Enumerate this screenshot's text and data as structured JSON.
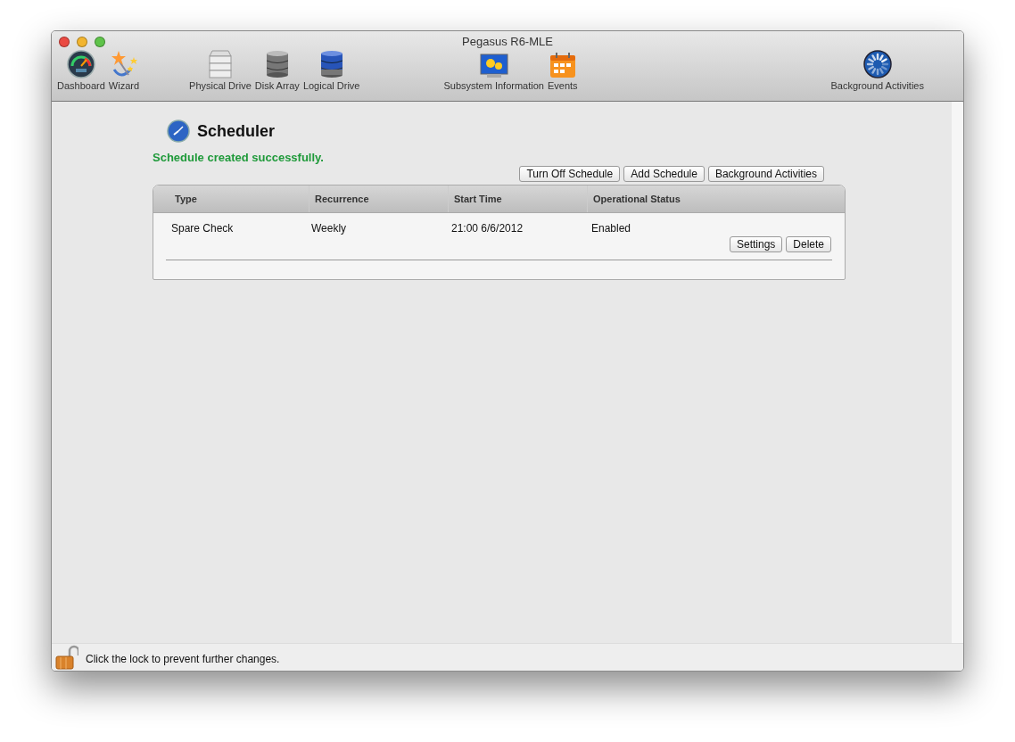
{
  "window": {
    "title": "Pegasus R6-MLE"
  },
  "toolbar": [
    {
      "label": "Dashboard",
      "kind": "gauge"
    },
    {
      "label": "Wizard",
      "kind": "wand"
    },
    {
      "label": "Physical Drive",
      "kind": "drive"
    },
    {
      "label": "Disk Array",
      "kind": "array"
    },
    {
      "label": "Logical Drive",
      "kind": "logical"
    },
    {
      "label": "Subsystem Information",
      "kind": "monitor"
    },
    {
      "label": "Events",
      "kind": "calendar"
    },
    {
      "label": "Background Activities",
      "kind": "spinner"
    }
  ],
  "page": {
    "title": "Scheduler",
    "message": "Schedule created successfully.",
    "actions": [
      "Turn Off Schedule",
      "Add Schedule",
      "Background Activities"
    ]
  },
  "table": {
    "columns": [
      "Type",
      "Recurrence",
      "Start Time",
      "Operational Status"
    ],
    "rows": [
      {
        "cells": [
          "Spare Check",
          "Weekly",
          "21:00 6/6/2012",
          "Enabled"
        ],
        "buttons": [
          "Settings",
          "Delete"
        ]
      }
    ]
  },
  "status_bar": {
    "text": "Click the lock to prevent further changes.",
    "locked": false
  }
}
